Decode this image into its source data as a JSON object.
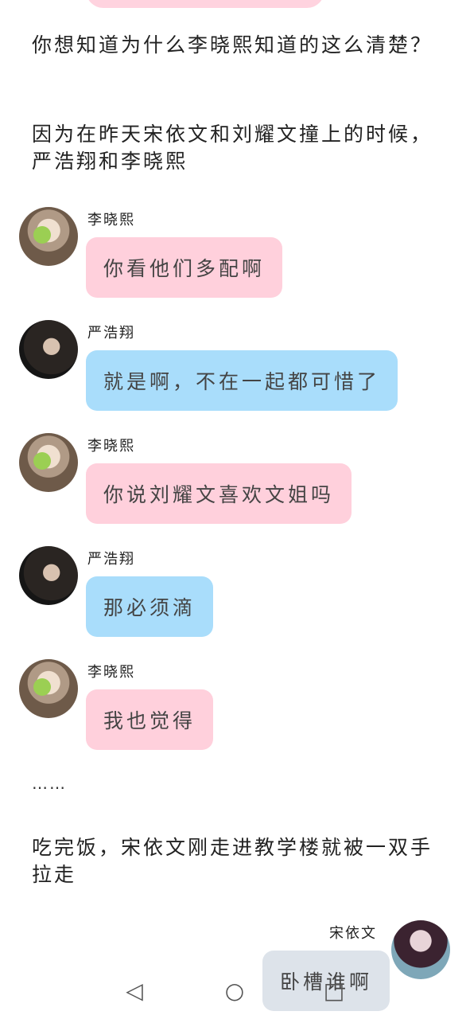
{
  "story": {
    "para1": "你想知道为什么李晓熙知道的这么清楚？",
    "para2": "因为在昨天宋依文和刘耀文撞上的时候，严浩翔和李晓熙",
    "separator": "……",
    "para3": "吃完饭，宋依文刚走进教学楼就被一双手拉走"
  },
  "messages": [
    {
      "sender": "李晓熙",
      "text": "你看他们多配啊",
      "color": "#ffd0dc"
    },
    {
      "sender": "严浩翔",
      "text": "就是啊，不在一起都可惜了",
      "color": "#a9ddfb"
    },
    {
      "sender": "李晓熙",
      "text": "你说刘耀文喜欢文姐吗",
      "color": "#ffd0dc"
    },
    {
      "sender": "严浩翔",
      "text": "那必须滴",
      "color": "#a9ddfb"
    },
    {
      "sender": "李晓熙",
      "text": "我也觉得",
      "color": "#ffd0dc"
    },
    {
      "sender": "宋依文",
      "text": "卧槽谁啊",
      "color": "#dde3ea"
    }
  ],
  "navbar": {
    "back_icon": "◁",
    "home_icon": "○",
    "recents_icon": "□"
  }
}
